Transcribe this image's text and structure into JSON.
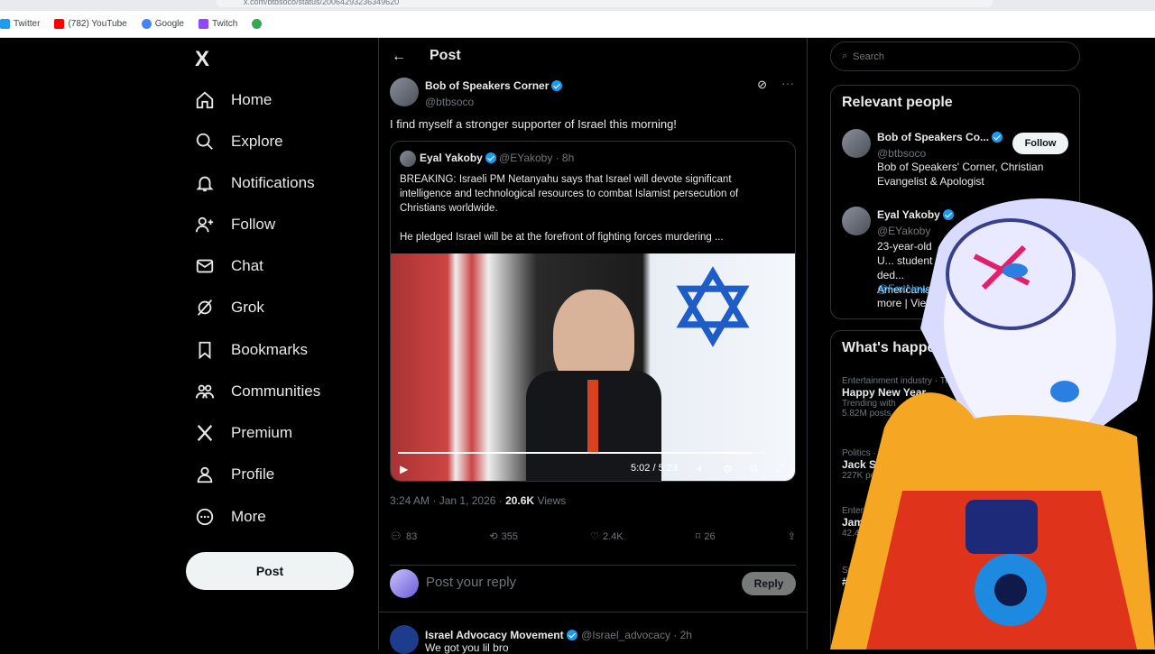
{
  "browser": {
    "url": "x.com/btbsoco/status/20064293236349620",
    "bookmarks": [
      "Twitter",
      "(782) YouTube",
      "Google",
      "Twitch"
    ]
  },
  "nav": {
    "logo": "X",
    "items": [
      "Home",
      "Explore",
      "Notifications",
      "Follow",
      "Chat",
      "Grok",
      "Bookmarks",
      "Communities",
      "Premium",
      "Profile",
      "More"
    ],
    "post_button": "Post"
  },
  "header": {
    "title": "Post"
  },
  "post": {
    "author_name": "Bob of Speakers Corner",
    "author_handle": "@btbsoco",
    "text": "I find myself a stronger supporter of Israel this morning!",
    "quote": {
      "author_name": "Eyal Yakoby",
      "author_handle": "@EYakoby",
      "age": "· 8h",
      "text": "BREAKING: Israeli PM Netanyahu says that Israel will devote significant intelligence and technological resources to combat Islamist persecution of Christians worldwide.\n\nHe pledged Israel will be at the forefront of fighting forces murdering ...",
      "video_time": "5:02 / 5:23",
      "video_progress": 0.96
    },
    "timestamp": "3:24 AM · Jan 1, 2026 · ",
    "views_count": "20.6K",
    "views_label": " Views",
    "replies": "83",
    "reposts": "355",
    "likes": "2.4K",
    "bookmarks": "26"
  },
  "reply": {
    "placeholder": "Post your reply",
    "button": "Reply"
  },
  "next_post": {
    "author_name": "Israel Advocacy Movement",
    "author_handle": "@Israel_advocacy · 2h",
    "text": "We got you lil bro"
  },
  "search": {
    "placeholder": "Search"
  },
  "relevant": {
    "title": "Relevant people",
    "people": [
      {
        "name": "Bob of Speakers Co...",
        "handle": "@btbsoco",
        "bio": "Bob of Speakers' Corner, Christian Evangelist & Apologist",
        "action": "Follow"
      },
      {
        "name": "Eyal Yakoby",
        "handle": "@EYakoby",
        "bio": "23-year-old U... student ded... Americanis...",
        "link": "@FoxNews",
        "more": "more | View"
      }
    ]
  },
  "trends": {
    "title": "What's happen",
    "items": [
      {
        "category": "Entertainment industry · Tr",
        "name": "Happy New Year",
        "meta": "Trending with",
        "count": "5.82M posts"
      },
      {
        "category": "Politics · Tr",
        "name": "Jack Smit",
        "count": "227K posts"
      },
      {
        "category": "Entertainm",
        "name": "Jamie",
        "count": "42.4K"
      },
      {
        "category": "Sp",
        "name": "#",
        "count": ""
      }
    ]
  },
  "colors": {
    "accent": "#1d9bf0",
    "background": "#000000",
    "border": "#2f3336"
  }
}
